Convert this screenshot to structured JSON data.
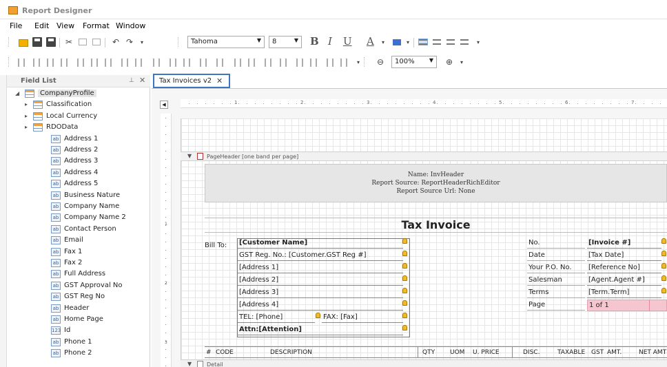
{
  "app": {
    "title": "Report Designer"
  },
  "menu": [
    "File",
    "Edit",
    "View",
    "Format",
    "Window"
  ],
  "toolbar": {
    "font_family": "Tahoma",
    "font_size": "8",
    "bold_label": "B",
    "italic_label": "I",
    "underline_label": "U",
    "font_color_label": "A",
    "zoom": "100%"
  },
  "field_list": {
    "title": "Field List",
    "root": "CompanyProfile",
    "tables": [
      "Classification",
      "Local Currency",
      "RDOData"
    ],
    "fields": [
      "Address 1",
      "Address 2",
      "Address 3",
      "Address 4",
      "Address 5",
      "Business Nature",
      "Company Name",
      "Company Name 2",
      "Contact Person",
      "Email",
      "Fax 1",
      "Fax 2",
      "Full Address",
      "GST Approval No",
      "GST Reg No",
      "Header",
      "Home Page",
      "Id",
      "Phone 1",
      "Phone 2"
    ],
    "field_types": {
      "Id": "123"
    },
    "ab_label": "ab"
  },
  "document_tab": {
    "label": "Tax Invoices v2"
  },
  "ruler": {
    "numbers": [
      "1",
      "2",
      "3",
      "4",
      "5",
      "6",
      "7"
    ],
    "vnumbers": [
      "1",
      "2",
      "3"
    ]
  },
  "bands": {
    "page_header": "PageHeader [one band per page]",
    "detail": "Detail"
  },
  "header_info": {
    "name": "Name: InvHeader",
    "source": "Report Source: ReportHeaderRichEditor",
    "source_url": "Report Source Url: None"
  },
  "invoice": {
    "title": "Tax Invoice",
    "bill_to_label": "Bill To:",
    "customer_name": "[Customer Name]",
    "gst_reg": "GST Reg. No.: [Customer.GST Reg #]",
    "address1": "[Address 1]",
    "address2": "[Address 2]",
    "address3": "[Address 3]",
    "address4": "[Address 4]",
    "tel": "TEL: [Phone]",
    "fax": "FAX: [Fax]",
    "attn": "Attn:[Attention]",
    "right_labels": [
      "No.",
      "Date",
      "Your P.O. No.",
      "Salesman",
      "Terms",
      "Page"
    ],
    "right_values": [
      "[Invoice #]",
      "[Tax Date]",
      "[Reference No]",
      "[Agent.Agent #]",
      "[Term.Term]",
      "1 of 1"
    ]
  },
  "columns": [
    "#",
    "CODE",
    "DESCRIPTION",
    "QTY",
    "UOM",
    "U. PRICE",
    "DISC.",
    "TAXABLE",
    "GST",
    "AMT.",
    "NET AMT"
  ]
}
